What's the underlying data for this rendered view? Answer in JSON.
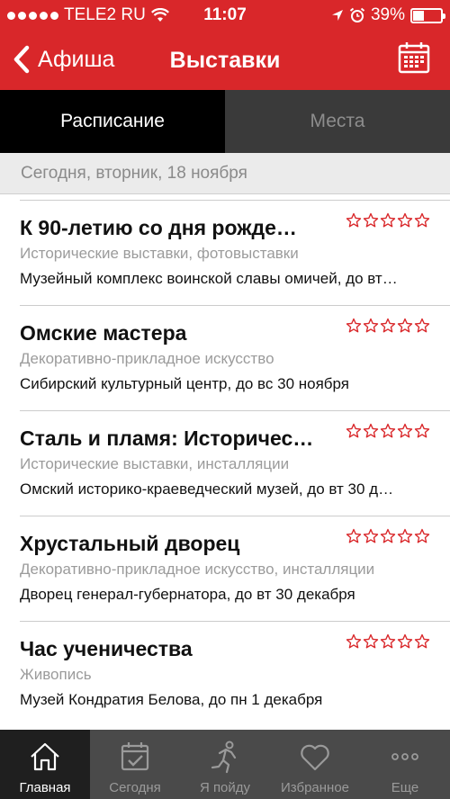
{
  "status_bar": {
    "carrier": "TELE2 RU",
    "time": "11:07",
    "battery": "39%",
    "battery_level": 0.39,
    "icons": [
      "signal-dots-icon",
      "wifi-icon",
      "location-arrow-icon",
      "alarm-icon",
      "battery-icon"
    ]
  },
  "nav": {
    "back_label": "Афиша",
    "title": "Выставки",
    "right_icon": "calendar-icon"
  },
  "tabs": [
    {
      "label": "Расписание",
      "active": true
    },
    {
      "label": "Места",
      "active": false
    }
  ],
  "date_header": "Сегодня, вторник, 18 ноября",
  "items": [
    {
      "title": "К 90-летию со дня рожде…",
      "category": "Исторические выставки, фотовыставки",
      "place": "Музейный комплекс воинской славы омичей, до вт…",
      "rating": 0
    },
    {
      "title": "Омские мастера",
      "category": "Декоративно-прикладное искусство",
      "place": "Сибирский культурный центр, до вс 30 ноября",
      "rating": 0
    },
    {
      "title": "Сталь и пламя: Историчес…",
      "category": "Исторические выставки, инсталляции",
      "place": "Омский историко-краеведческий музей, до вт 30 д…",
      "rating": 0
    },
    {
      "title": "Хрустальный дворец",
      "category": "Декоративно-прикладное искусство, инсталляции",
      "place": "Дворец генерал-губернатора, до вт 30 декабря",
      "rating": 0
    },
    {
      "title": "Час ученичества",
      "category": "Живопись",
      "place": "Музей Кондратия Белова, до пн 1 декабря",
      "rating": 0
    }
  ],
  "tab_bar": [
    {
      "label": "Главная",
      "icon": "home-icon",
      "active": true
    },
    {
      "label": "Сегодня",
      "icon": "calendar-check-icon",
      "active": false
    },
    {
      "label": "Я пойду",
      "icon": "runner-icon",
      "active": false
    },
    {
      "label": "Избранное",
      "icon": "heart-icon",
      "active": false
    },
    {
      "label": "Еще",
      "icon": "more-dots-icon",
      "active": false
    }
  ],
  "colors": {
    "brand_red": "#d9272a",
    "star_red": "#d9272a",
    "tab_active_bg": "#000000",
    "tab_inactive_bg": "#3a3a3a",
    "tabbar_bg": "#4a4a4a"
  }
}
